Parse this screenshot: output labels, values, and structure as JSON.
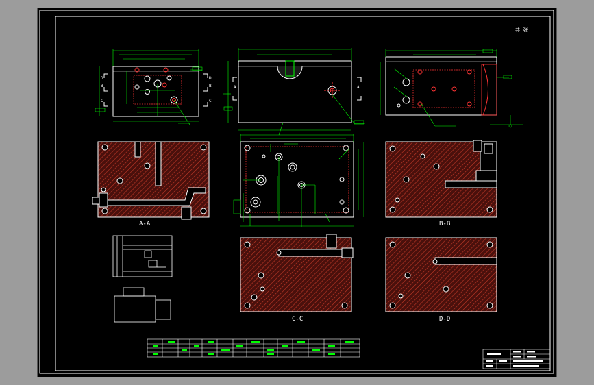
{
  "sheet": {
    "number": "共 张"
  },
  "views": {
    "top_ref_d": "D",
    "top_ref_b": "B",
    "top_ref_c": "C",
    "top_ref_d2": "D",
    "top_ref_b2": "B",
    "top_ref_c2": "C",
    "front_ref_a": "A",
    "front_ref_a2": "A"
  },
  "sections": {
    "aa": "A-A",
    "bb": "B-B",
    "cc": "C-C",
    "dd": "D-D"
  },
  "colors": {
    "frame": "#ffffff",
    "outline": "#ffffff",
    "dimension": "#00ff00",
    "hidden": "#ff0000",
    "hatch_fill": "#5a1410",
    "hatch_line": "#c03020",
    "annotation": "#ffff00"
  }
}
